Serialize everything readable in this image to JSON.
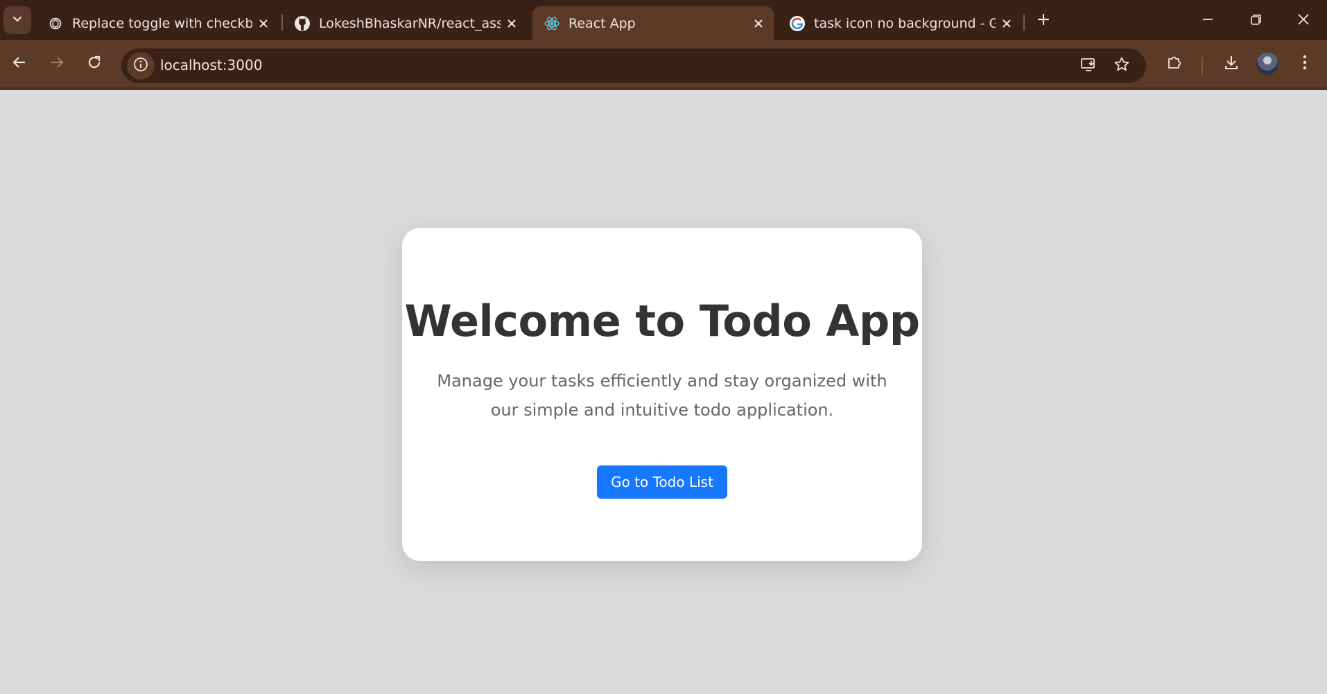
{
  "browser": {
    "tabs": [
      {
        "title": "Replace toggle with checkbox",
        "icon": "chatgpt-icon",
        "active": false
      },
      {
        "title": "LokeshBhaskarNR/react_assignm",
        "icon": "github-icon",
        "active": false
      },
      {
        "title": "React App",
        "icon": "react-icon",
        "active": true
      },
      {
        "title": "task icon no background - Goog",
        "icon": "google-icon",
        "active": false
      }
    ],
    "url": "localhost:3000",
    "colors": {
      "frame": "#3a2116",
      "toolbar": "#5b3b28",
      "text": "#f1e4dc"
    }
  },
  "page": {
    "title": "Welcome to Todo App",
    "description": "Manage your tasks efficiently and stay organized with our simple and intuitive todo application.",
    "cta_label": "Go to Todo List",
    "colors": {
      "background": "#dadada",
      "card": "#ffffff",
      "button": "#1677ff",
      "heading": "#333333",
      "body": "#666666"
    }
  }
}
